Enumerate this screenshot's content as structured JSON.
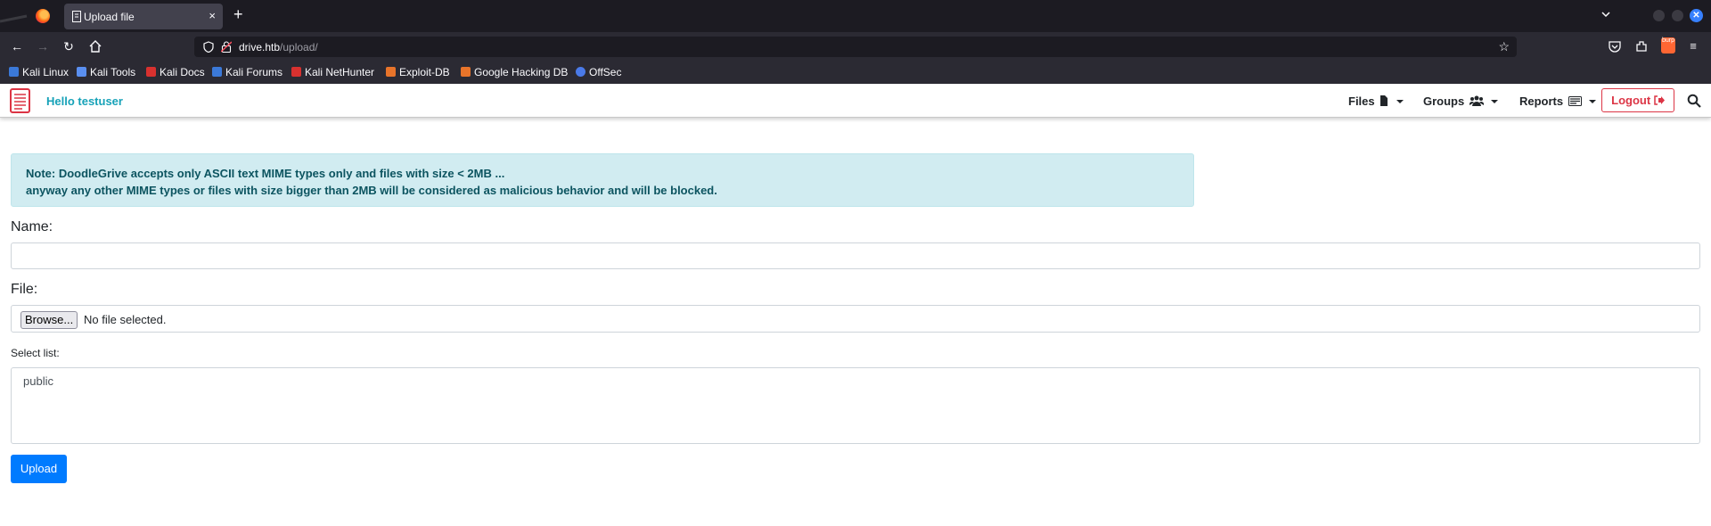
{
  "browser": {
    "tab_title": "Upload file",
    "tab_close": "×",
    "new_tab": "+",
    "url_host": "drive.htb",
    "url_path": "/upload/",
    "burp_label": "burp",
    "bookmarks": [
      "Kali Linux",
      "Kali Tools",
      "Kali Docs",
      "Kali Forums",
      "Kali NetHunter",
      "Exploit-DB",
      "Google Hacking DB",
      "OffSec"
    ]
  },
  "app": {
    "greeting": "Hello testuser",
    "menu_files": "Files",
    "menu_groups": "Groups",
    "menu_reports": "Reports",
    "logout": "Logout"
  },
  "alert": {
    "line1": "Note: DoodleGrive accepts only ASCII text MIME types only and files with size < 2MB ...",
    "line2": "anyway any other MIME types or files with size bigger than 2MB will be considered as malicious behavior and will be blocked."
  },
  "form": {
    "name_label": "Name:",
    "name_value": "",
    "file_label": "File:",
    "browse_label": "Browse...",
    "no_file": "No file selected.",
    "select_label": "Select list:",
    "options": [
      "public"
    ],
    "upload_label": "Upload"
  },
  "colors": {
    "accent_info": "#17a2b8",
    "danger": "#dc3545",
    "primary": "#007bff",
    "alert_bg": "#d1ecf1"
  }
}
